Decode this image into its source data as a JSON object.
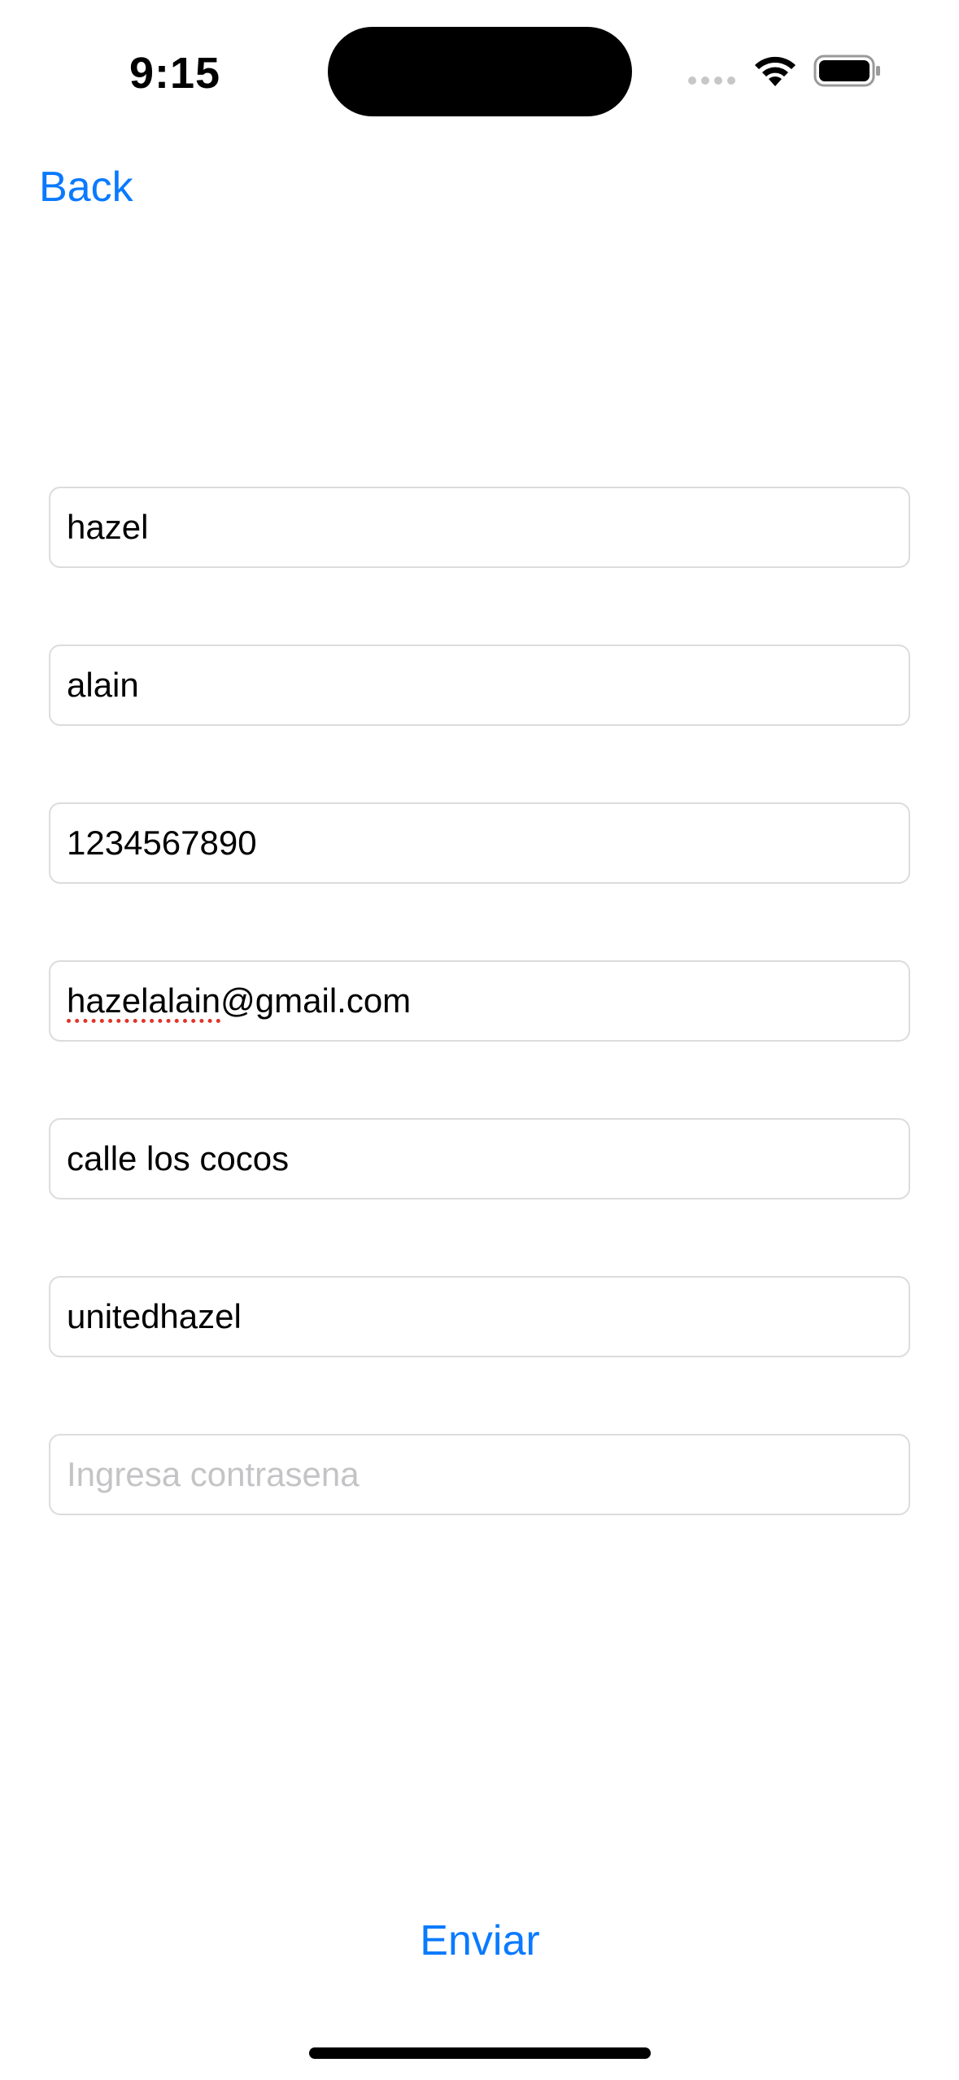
{
  "status_bar": {
    "time": "9:15"
  },
  "nav": {
    "back_label": "Back"
  },
  "form": {
    "fields": [
      {
        "value": "hazel",
        "placeholder": ""
      },
      {
        "value": "alain",
        "placeholder": ""
      },
      {
        "value": "1234567890",
        "placeholder": ""
      },
      {
        "value_misspelled_part": "hazelalain",
        "value_rest": "@gmail.com",
        "placeholder": ""
      },
      {
        "value": "calle los cocos",
        "placeholder": ""
      },
      {
        "value": "unitedhazel",
        "placeholder": ""
      },
      {
        "value": "",
        "placeholder": "Ingresa contrasena"
      }
    ],
    "submit_label": "Enviar"
  },
  "colors": {
    "accent": "#0a7aff",
    "field_border": "#dcdcdc",
    "placeholder": "#c4c4c7",
    "spellcheck": "#e0352b"
  }
}
